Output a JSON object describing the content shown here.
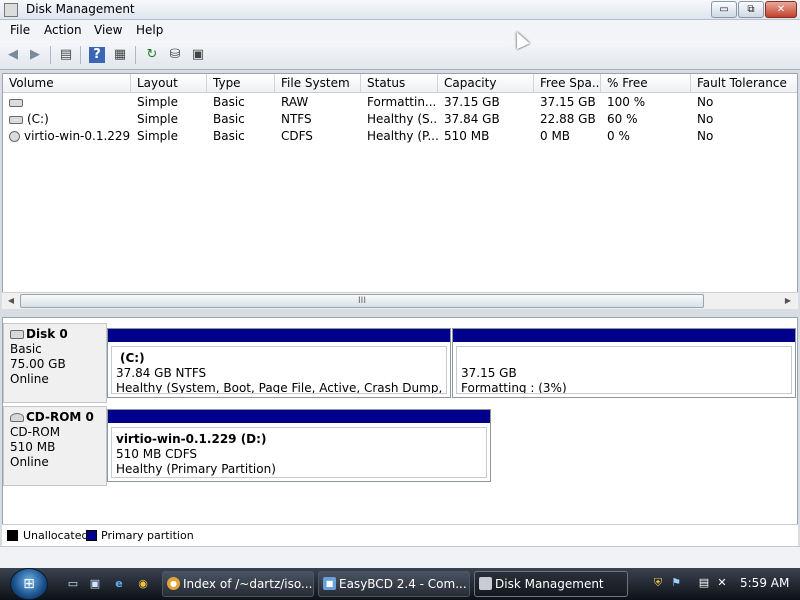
{
  "window": {
    "title": "Disk Management",
    "controls": {
      "minimize": "▭",
      "maximize": "⧉",
      "close": "✕"
    }
  },
  "menu": [
    "File",
    "Action",
    "View",
    "Help"
  ],
  "toolbar": {
    "icons": [
      "back-icon",
      "forward-icon",
      "console-tree-icon",
      "help-icon",
      "properties-pane-icon",
      "refresh-icon",
      "rescan-icon",
      "properties-icon"
    ]
  },
  "volume_list": {
    "columns": [
      "Volume",
      "Layout",
      "Type",
      "File System",
      "Status",
      "Capacity",
      "Free Spa...",
      "% Free",
      "Fault Tolerance"
    ],
    "rows": [
      [
        "",
        "Simple",
        "Basic",
        "RAW",
        "Formattin...",
        "37.15 GB",
        "37.15 GB",
        "100 %",
        "No"
      ],
      [
        "(C:)",
        "Simple",
        "Basic",
        "NTFS",
        "Healthy (S...",
        "37.84 GB",
        "22.88 GB",
        "60 %",
        "No"
      ],
      [
        "virtio-win-0.1.229 ...",
        "Simple",
        "Basic",
        "CDFS",
        "Healthy (P...",
        "510 MB",
        "0 MB",
        "0 %",
        "No"
      ]
    ],
    "scroll_grip": "III"
  },
  "disks": [
    {
      "name": "Disk 0",
      "type": "Basic",
      "size": "75.00 GB",
      "state": "Online",
      "partitions": [
        {
          "name": "(C:)",
          "size_fs": "37.84 GB NTFS",
          "status": "Healthy (System, Boot, Page File, Active, Crash Dump, Primary"
        },
        {
          "name": "",
          "size_fs": "37.15 GB",
          "status": "Formatting : (3%)"
        }
      ]
    },
    {
      "name": "CD-ROM 0",
      "type": "CD-ROM",
      "size": "510 MB",
      "state": "Online",
      "partitions": [
        {
          "name": "virtio-win-0.1.229  (D:)",
          "size_fs": "510 MB CDFS",
          "status": "Healthy (Primary Partition)"
        }
      ]
    }
  ],
  "legend": [
    {
      "label": "Unallocated",
      "color": "#000000"
    },
    {
      "label": "Primary partition",
      "color": "#00008b"
    }
  ],
  "taskbar": {
    "start_label": "⊞",
    "tasks": [
      {
        "label": "Index of /~dartz/iso...",
        "icon": "chrome-icon"
      },
      {
        "label": "EasyBCD 2.4 - Com...",
        "icon": "easybcd-icon"
      },
      {
        "label": "Disk Management",
        "icon": "disk-management-icon"
      }
    ],
    "clock": "5:59 AM"
  }
}
